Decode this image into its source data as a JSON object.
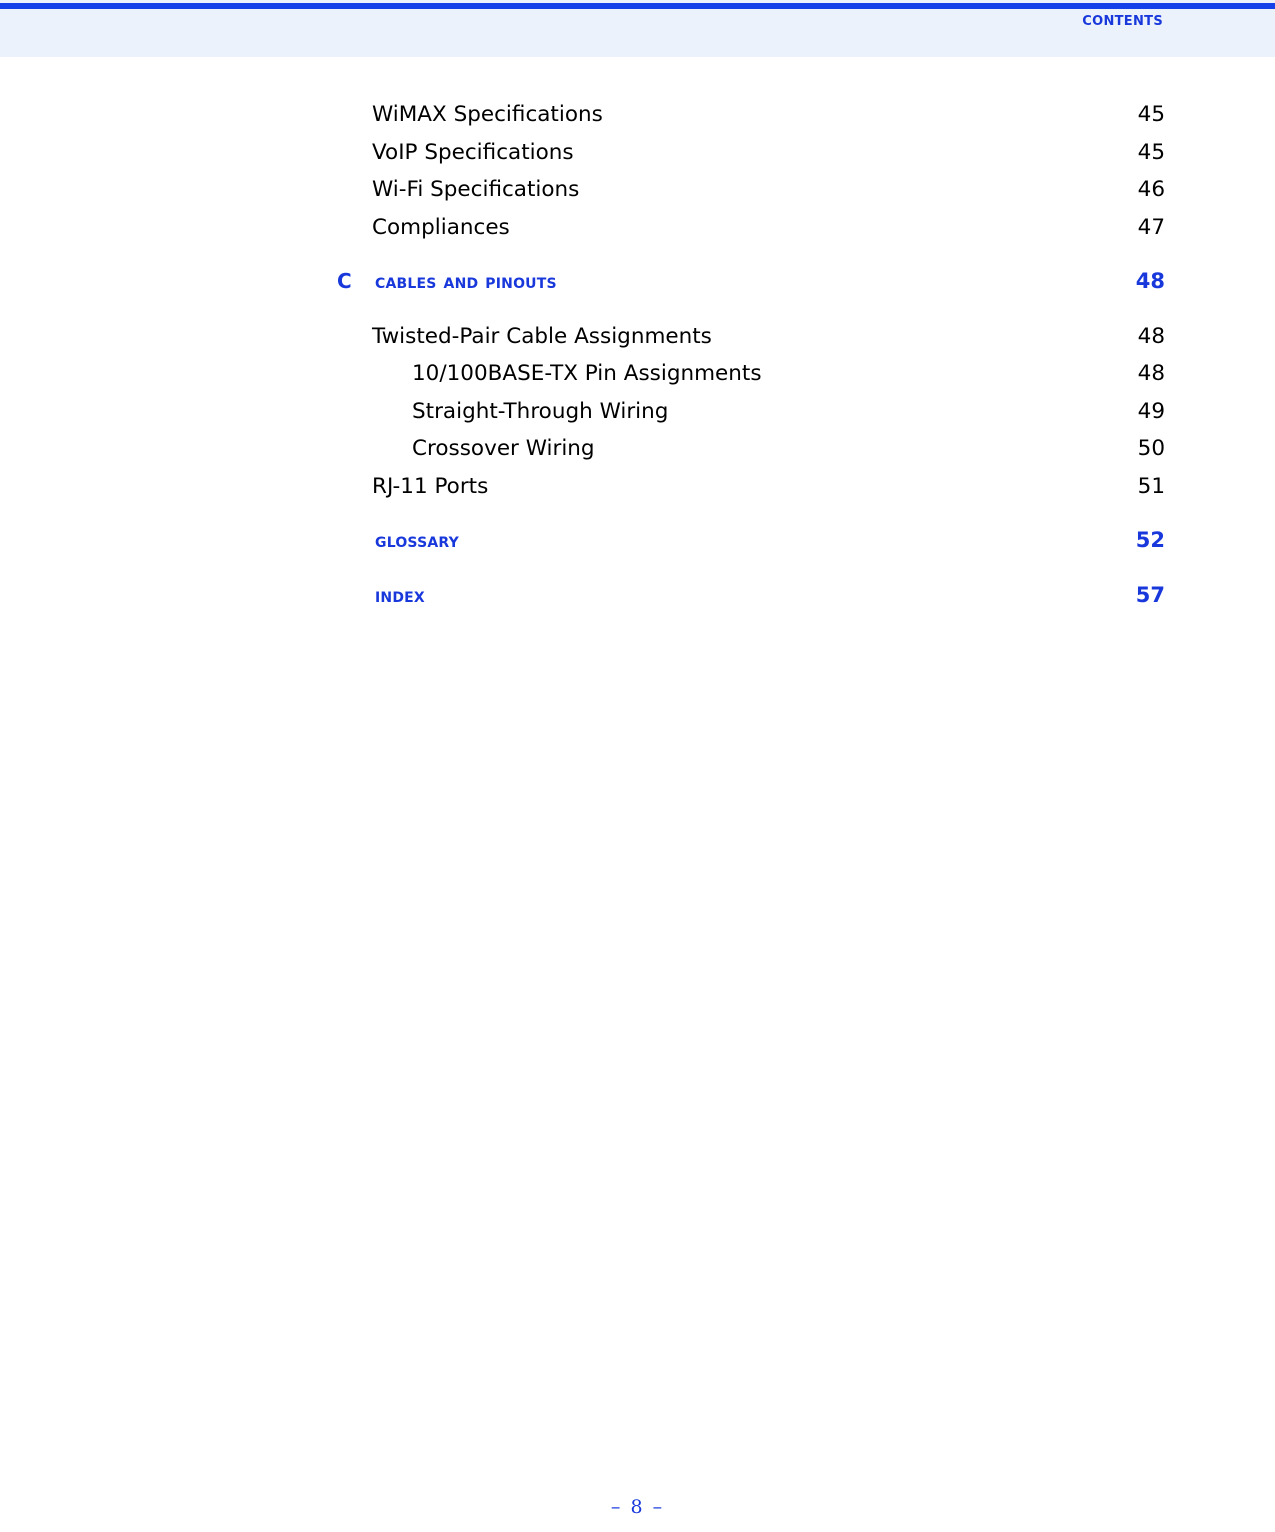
{
  "header": {
    "title": "Contents",
    "rule_color": "#1340e8",
    "band_color": "#ebf2fb",
    "accent_color": "#1838dc"
  },
  "toc": {
    "entries": [
      {
        "chapter": "",
        "label": "WiMAX Specifications",
        "page": "45",
        "level": 1,
        "heading": false,
        "gap_before": false
      },
      {
        "chapter": "",
        "label": "VoIP Specifications",
        "page": "45",
        "level": 1,
        "heading": false,
        "gap_before": false
      },
      {
        "chapter": "",
        "label": "Wi-Fi Specifications",
        "page": "46",
        "level": 1,
        "heading": false,
        "gap_before": false
      },
      {
        "chapter": "",
        "label": "Compliances",
        "page": "47",
        "level": 1,
        "heading": false,
        "gap_before": false
      },
      {
        "chapter": "C",
        "label": "Cables and Pinouts",
        "page": "48",
        "level": 0,
        "heading": true,
        "gap_before": true
      },
      {
        "chapter": "",
        "label": "Twisted-Pair Cable Assignments",
        "page": "48",
        "level": 1,
        "heading": false,
        "gap_before": true
      },
      {
        "chapter": "",
        "label": "10/100BASE-TX Pin Assignments",
        "page": "48",
        "level": 2,
        "heading": false,
        "gap_before": false
      },
      {
        "chapter": "",
        "label": "Straight-Through Wiring",
        "page": "49",
        "level": 2,
        "heading": false,
        "gap_before": false
      },
      {
        "chapter": "",
        "label": "Crossover Wiring",
        "page": "50",
        "level": 2,
        "heading": false,
        "gap_before": false
      },
      {
        "chapter": "",
        "label": "RJ-11 Ports",
        "page": "51",
        "level": 1,
        "heading": false,
        "gap_before": false
      },
      {
        "chapter": "",
        "label": "Glossary",
        "page": "52",
        "level": 0,
        "heading": true,
        "gap_before": true
      },
      {
        "chapter": "",
        "label": "Index",
        "page": "57",
        "level": 0,
        "heading": true,
        "gap_before": true
      }
    ]
  },
  "footer": {
    "page_marker": "–  8  –"
  }
}
